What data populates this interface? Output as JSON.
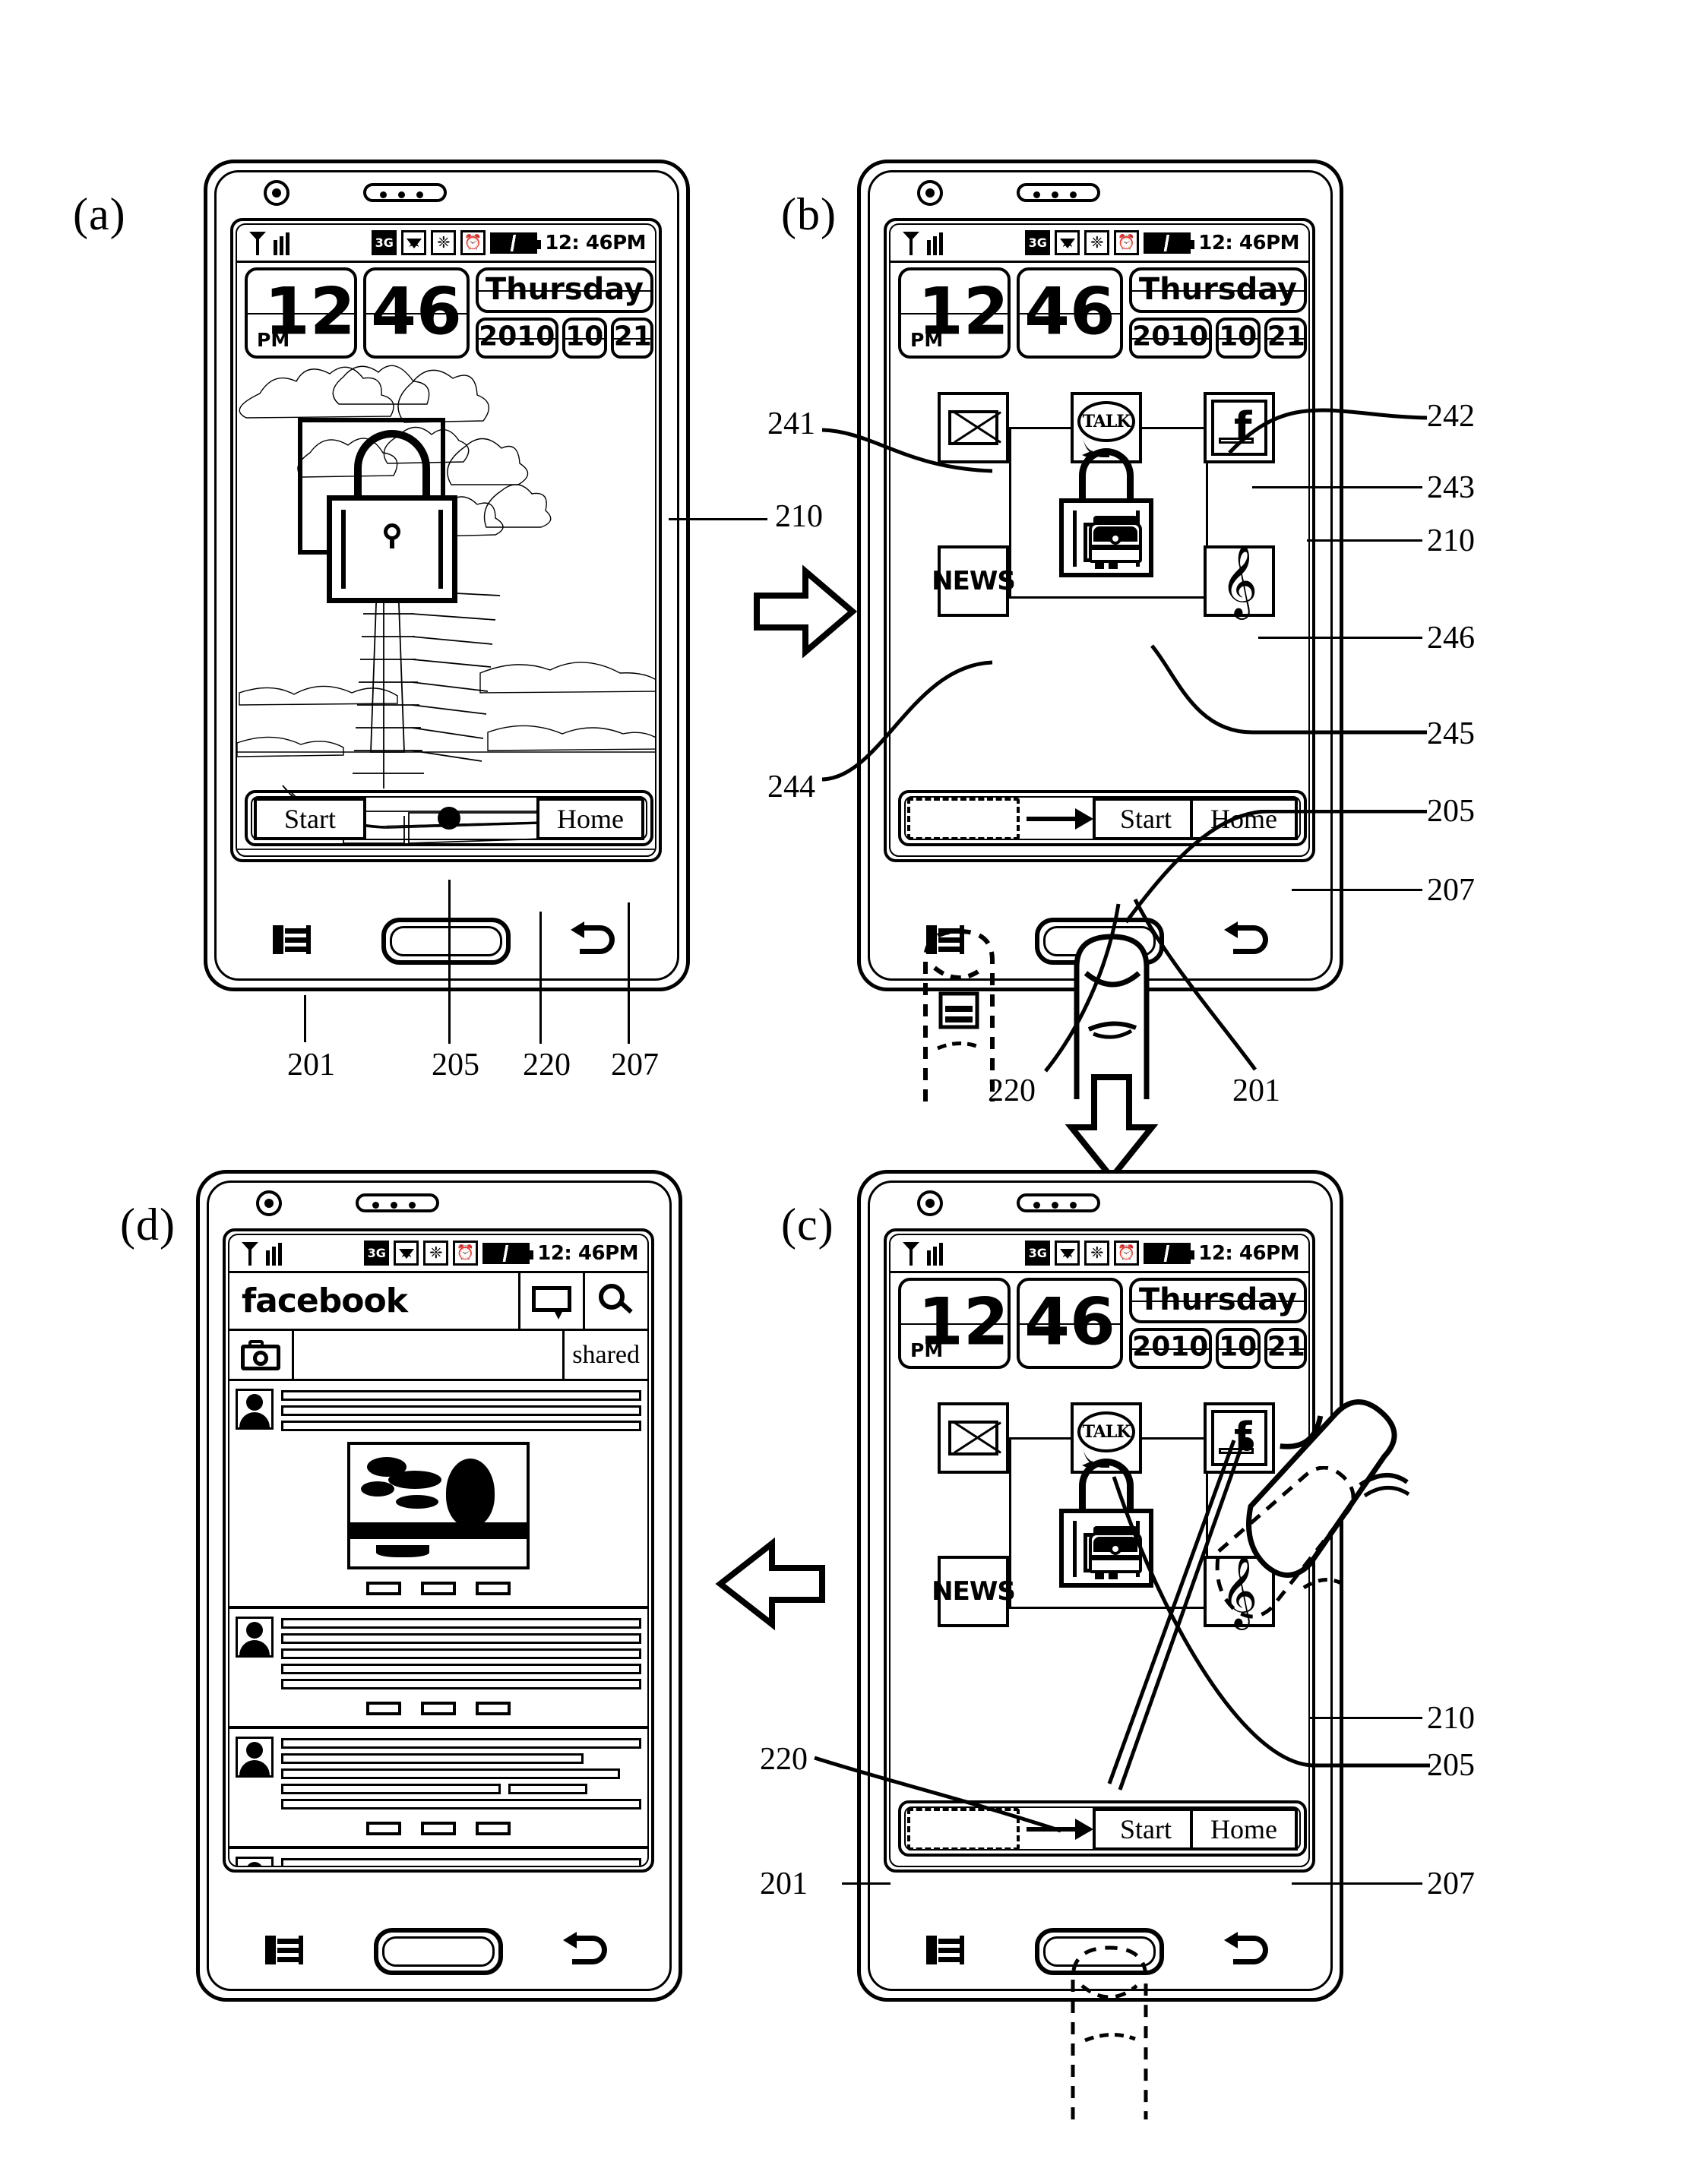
{
  "figure": {
    "panels": [
      {
        "id": "a",
        "label": "(a)"
      },
      {
        "id": "b",
        "label": "(b)"
      },
      {
        "id": "c",
        "label": "(c)"
      },
      {
        "id": "d",
        "label": "(d)"
      }
    ]
  },
  "status_bar": {
    "signal_icon": "signal-bars-icon",
    "network_label": "3G",
    "wifi_icon": "wifi-icon",
    "bluetooth_icon": "bluetooth-icon",
    "alarm_icon": "alarm-icon",
    "battery_icon": "battery-icon",
    "time": "12: 46PM"
  },
  "clock_widget": {
    "hour": "12",
    "meridiem": "PM",
    "minute": "46",
    "weekday": "Thursday",
    "year": "2010",
    "month": "10",
    "day": "21"
  },
  "lock_apps": [
    {
      "ref": "241",
      "name": "mail",
      "label": "",
      "icon": "envelope-icon"
    },
    {
      "ref": "242",
      "name": "talk",
      "label": "TALK",
      "icon": "speech-bubble-icon"
    },
    {
      "ref": "243",
      "name": "facebook",
      "label": "f",
      "icon": "facebook-f-icon"
    },
    {
      "ref": "244",
      "name": "news",
      "label": "NEWS",
      "icon": "news-icon"
    },
    {
      "ref": "246",
      "name": "music",
      "label": "♩",
      "icon": "music-note-icon"
    },
    {
      "ref": "245",
      "name": "lock",
      "label": "",
      "icon": "padlock-icon"
    }
  ],
  "soft_keys": {
    "start_label": "Start",
    "home_label": "Home",
    "tray_hint_icon": "drag-target-icon",
    "arrow_icon": "right-arrow-icon"
  },
  "hardware_keys": {
    "menu_icon": "menu-key-icon",
    "home_icon": "home-key-icon",
    "back_icon": "back-key-icon"
  },
  "facebook_app": {
    "title": "facebook",
    "chat_icon": "chat-bubble-icon",
    "search_icon": "search-icon",
    "camera_icon": "camera-icon",
    "shared_label": "shared",
    "posts": [
      {
        "avatar": "user-avatar",
        "text_lines": 3,
        "has_image": true,
        "actions": 3
      },
      {
        "avatar": "user-avatar",
        "text_lines": 5,
        "has_image": false,
        "actions": 3
      },
      {
        "avatar": "user-avatar",
        "text_lines": 5,
        "has_image": false,
        "actions": 3
      },
      {
        "avatar": "user-avatar",
        "text_lines": 2,
        "has_image": false,
        "actions": 0
      }
    ]
  },
  "reference_numerals": {
    "r201": "201",
    "r205": "205",
    "r207": "207",
    "r210": "210",
    "r220": "220",
    "r241": "241",
    "r242": "242",
    "r243": "243",
    "r244": "244",
    "r245": "245",
    "r246": "246"
  },
  "colors": {
    "ink": "#000000",
    "paper": "#ffffff"
  }
}
